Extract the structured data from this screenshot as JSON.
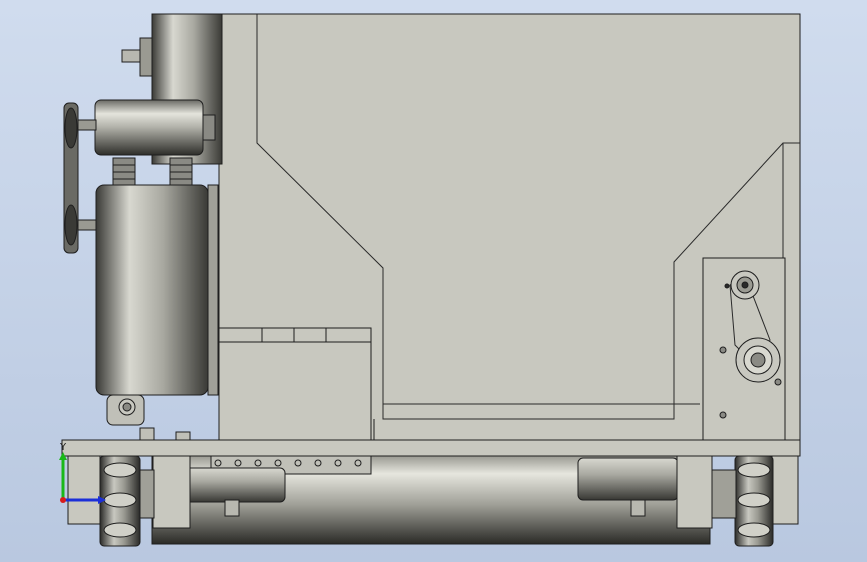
{
  "viewport": {
    "background_top": "#d0dcee",
    "background_bottom": "#b9c8e0",
    "body_color": "#c8c8bf",
    "edge_color": "#1e1e1e"
  },
  "triad": {
    "y_label": "Y",
    "x_color": "#1b2fd8",
    "y_color": "#19b819",
    "z_color": "#d81b1b"
  }
}
